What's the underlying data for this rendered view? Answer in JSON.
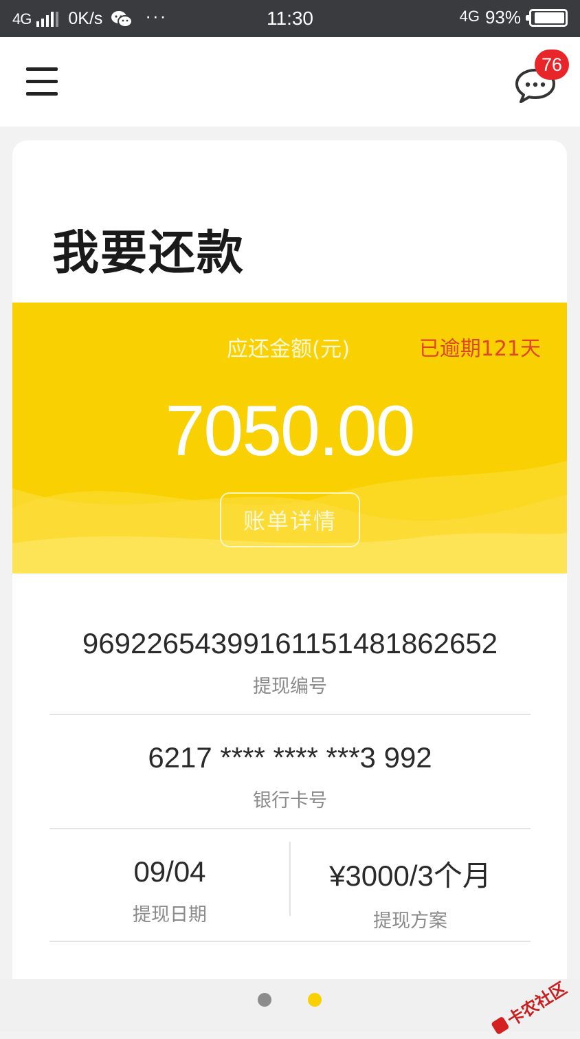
{
  "status_bar": {
    "network": "4G",
    "speed": "0K/s",
    "time": "11:30",
    "network_right": "4G",
    "battery": "93%",
    "battery_level": 0.93,
    "icons": [
      "signal-icon",
      "wechat-icon",
      "more-dots-icon",
      "battery-icon"
    ]
  },
  "header": {
    "menu_icon": "hamburger-menu-icon",
    "chat_icon": "chat-bubble-icon",
    "badge_count": "76"
  },
  "repayment": {
    "title": "我要还款",
    "amount_label": "应还金额(元)",
    "overdue_text": "已逾期121天",
    "amount": "7050.00",
    "bill_detail_label": "账单详情"
  },
  "details": {
    "withdraw_no": "969226543991611514818626​52",
    "withdraw_no_label": "提现编号",
    "bank_card": "6217 **** **** ***3 992",
    "bank_card_label": "银行卡号",
    "withdraw_date": "09/04",
    "withdraw_date_label": "提现日期",
    "withdraw_plan": "¥3000/3个月",
    "withdraw_plan_label": "提现方案"
  },
  "pager": {
    "pages": 2,
    "active_index": 1
  },
  "watermark": "卡农社区",
  "colors": {
    "status_bar": "#3a3b3f",
    "banner_yellow": "#f9d102",
    "overdue_red": "#e0452a",
    "badge_red": "#e8262a",
    "dot_inactive": "#8c8c8c",
    "dot_active": "#f9d102"
  }
}
